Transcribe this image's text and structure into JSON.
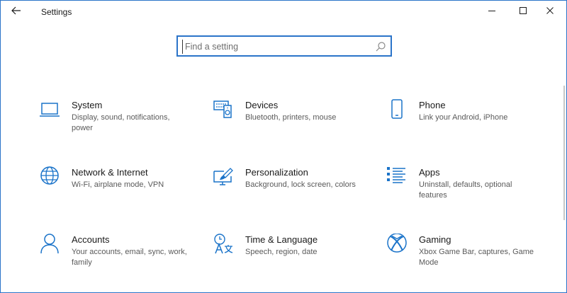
{
  "window": {
    "title": "Settings"
  },
  "search": {
    "placeholder": "Find a setting",
    "value": ""
  },
  "colors": {
    "accent": "#2b74c9",
    "icon": "#1a73c9"
  },
  "tiles": [
    {
      "title": "System",
      "desc": "Display, sound, notifications, power",
      "icon": "laptop-icon"
    },
    {
      "title": "Devices",
      "desc": "Bluetooth, printers, mouse",
      "icon": "devices-icon"
    },
    {
      "title": "Phone",
      "desc": "Link your Android, iPhone",
      "icon": "phone-icon"
    },
    {
      "title": "Network & Internet",
      "desc": "Wi-Fi, airplane mode, VPN",
      "icon": "globe-icon"
    },
    {
      "title": "Personalization",
      "desc": "Background, lock screen, colors",
      "icon": "paintbrush-icon"
    },
    {
      "title": "Apps",
      "desc": "Uninstall, defaults, optional features",
      "icon": "apps-list-icon"
    },
    {
      "title": "Accounts",
      "desc": "Your accounts, email, sync, work, family",
      "icon": "person-icon"
    },
    {
      "title": "Time & Language",
      "desc": "Speech, region, date",
      "icon": "time-language-icon"
    },
    {
      "title": "Gaming",
      "desc": "Xbox Game Bar, captures, Game Mode",
      "icon": "xbox-icon"
    }
  ]
}
